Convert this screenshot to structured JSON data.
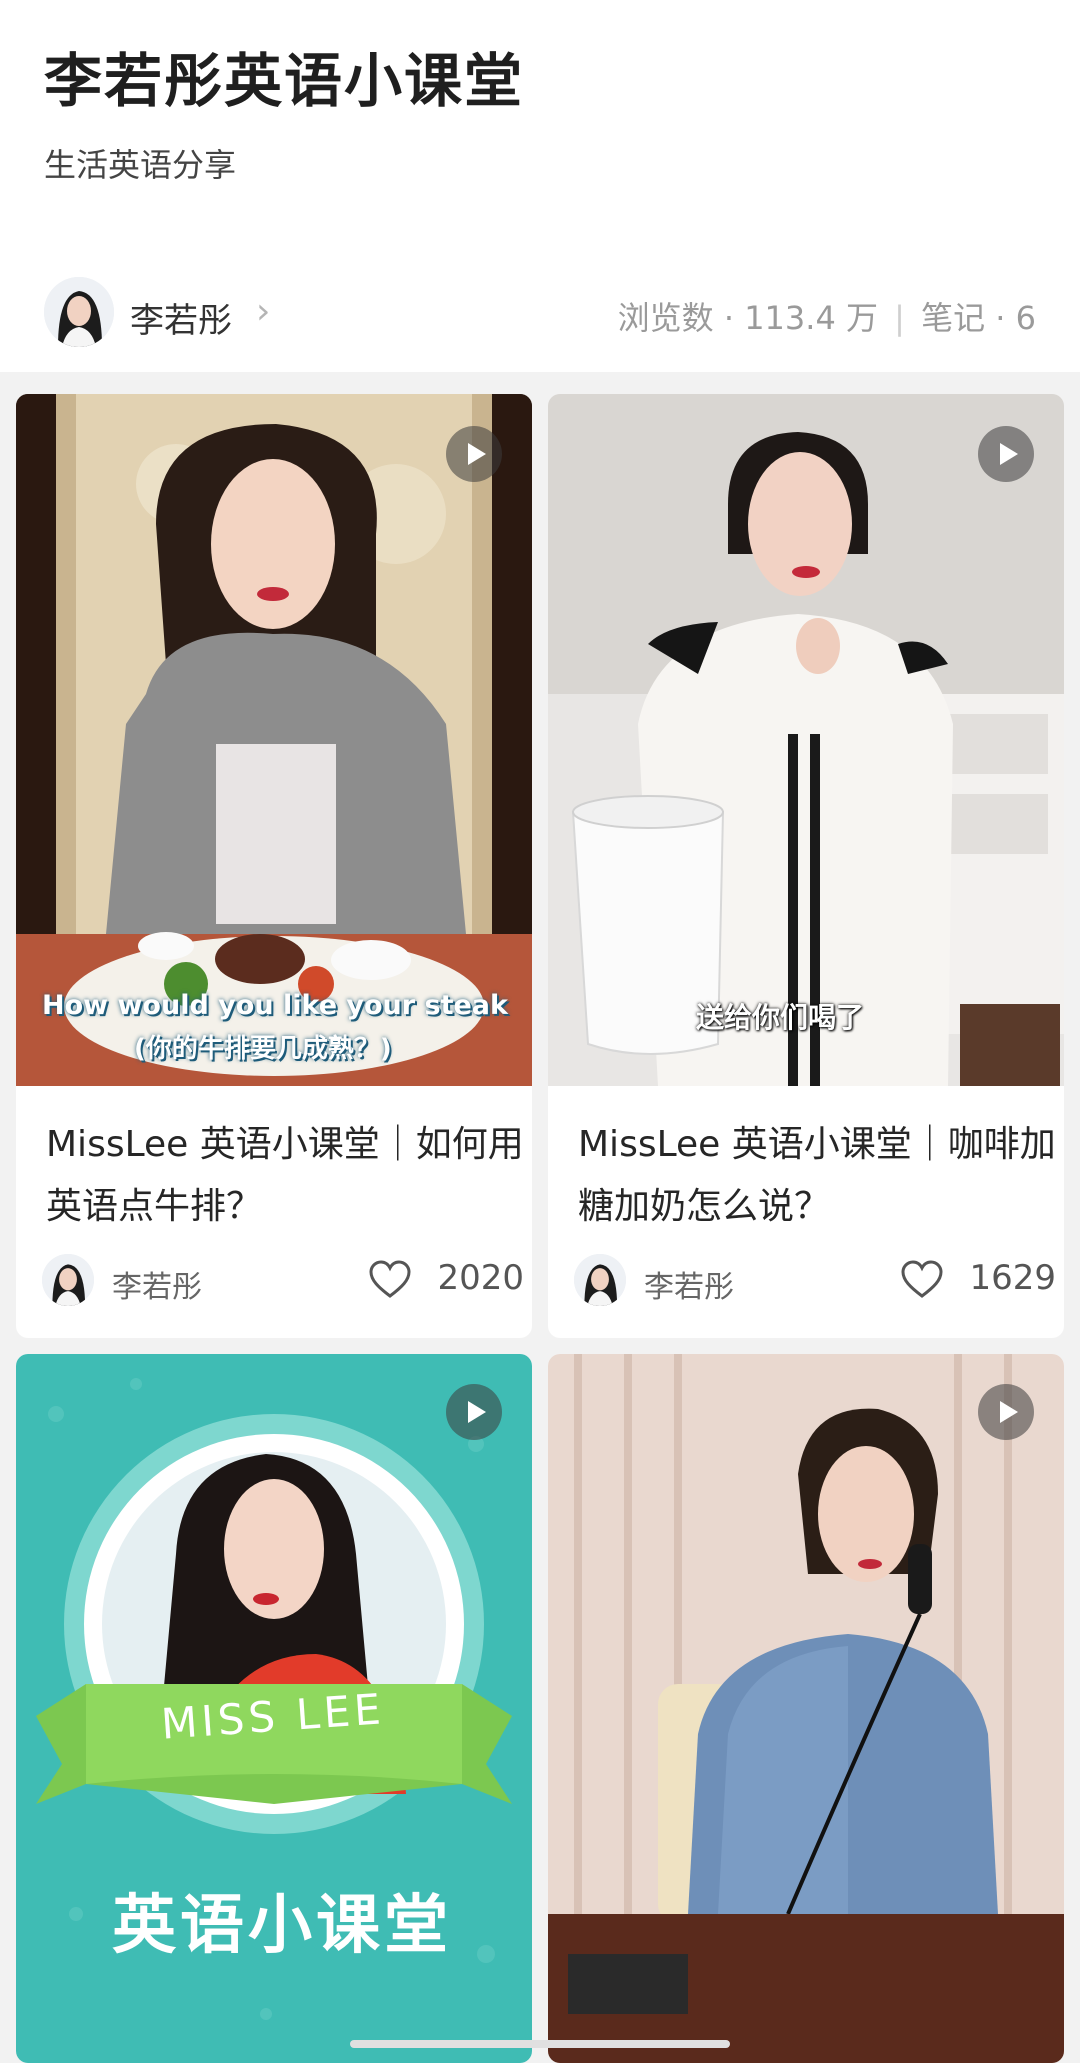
{
  "header": {
    "title": "李若彤英语小课堂",
    "subtitle": "生活英语分享",
    "author": {
      "name": "李若彤",
      "chevron": "›"
    },
    "stats": {
      "views_label": "浏览数",
      "views_value": "113.4 万",
      "notes_label": "笔记",
      "notes_value": "6",
      "dot": "·",
      "separator": "|"
    }
  },
  "cards": [
    {
      "title": "MissLee 英语小课堂｜如何用英语点牛排？",
      "author": "李若彤",
      "likes": "2020",
      "overlay_en": "How would you like your steak",
      "overlay_cn": "(你的牛排要几成熟？)"
    },
    {
      "title": "MissLee 英语小课堂｜咖啡加糖加奶怎么说？",
      "author": "李若彤",
      "likes": "1629",
      "overlay_cn": "送给你们喝了"
    },
    {
      "banner_text": "MISS LEE",
      "big_text": "英语小课堂"
    },
    {}
  ],
  "icons": {
    "play": "play-icon",
    "heart": "heart-icon",
    "chevron": "chevron-right-icon"
  },
  "colors": {
    "teal": "#3fbcb4",
    "green_banner": "#7cc850",
    "play_bg": "#5a5a5a"
  }
}
